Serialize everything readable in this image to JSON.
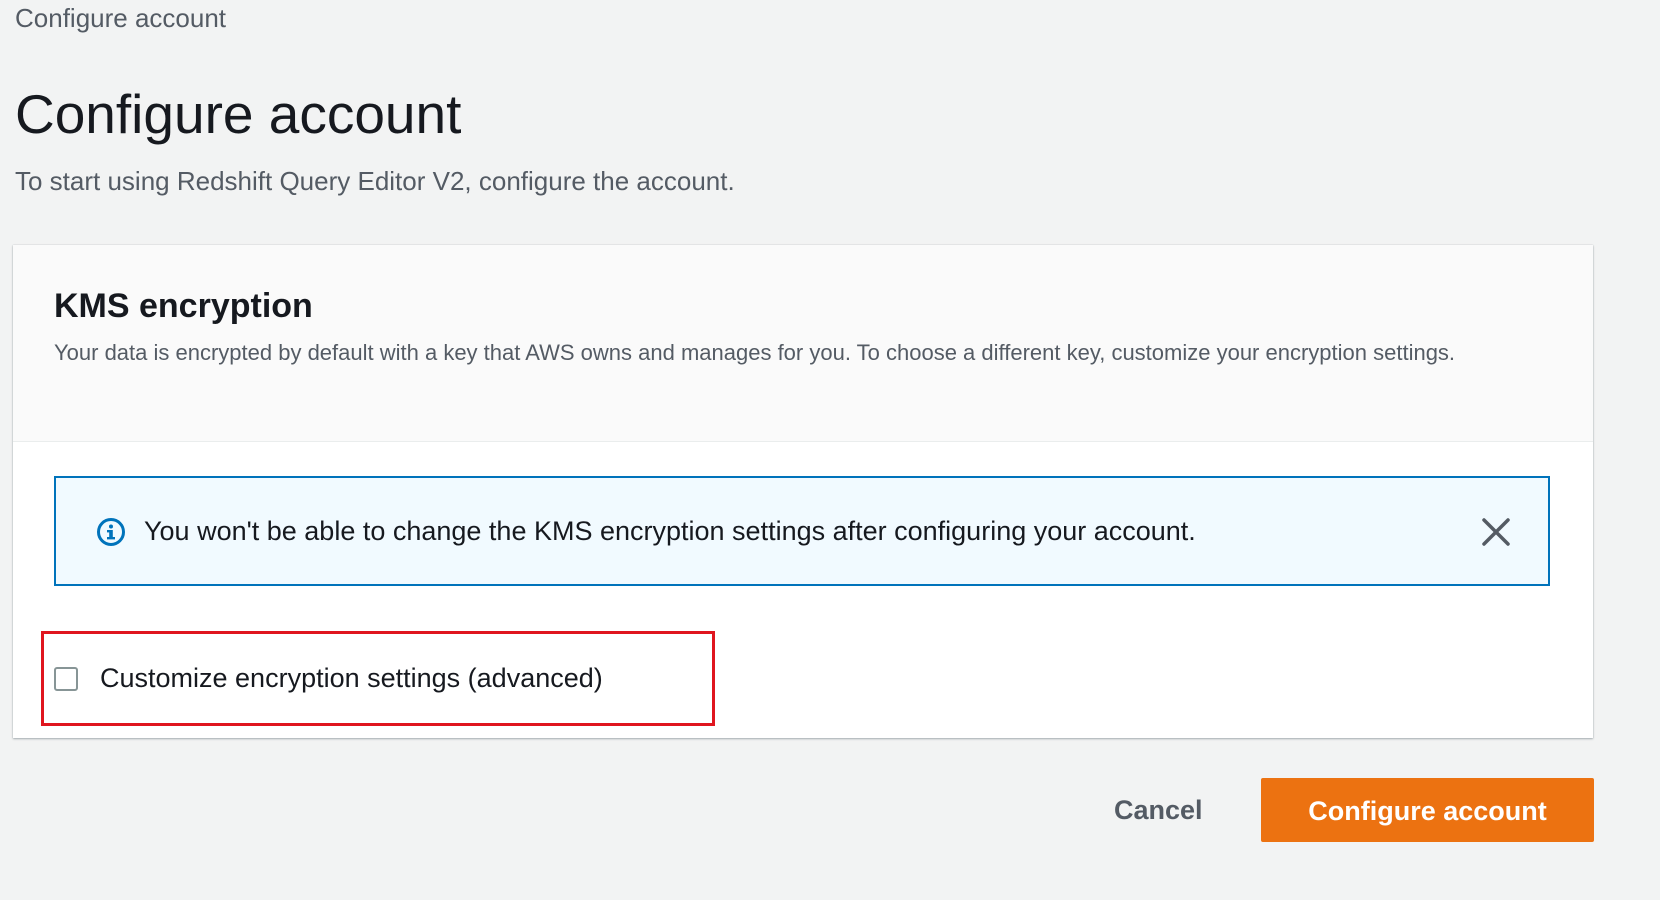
{
  "breadcrumb": {
    "label": "Configure account"
  },
  "page": {
    "title": "Configure account",
    "subtitle": "To start using Redshift Query Editor V2, configure the account."
  },
  "kms": {
    "title": "KMS encryption",
    "description": "Your data is encrypted by default with a key that AWS owns and manages for you. To choose a different key, customize your encryption settings.",
    "alert": {
      "icon": "info-icon",
      "text": "You won't be able to change the KMS encryption settings after configuring your account.",
      "close_icon": "close-icon"
    },
    "checkbox": {
      "label": "Customize encryption settings (advanced)",
      "checked": false
    }
  },
  "actions": {
    "cancel_label": "Cancel",
    "submit_label": "Configure account"
  },
  "colors": {
    "primary": "#ec7211",
    "info_border": "#0073bb",
    "info_background": "#f1faff",
    "highlight": "#e0161f"
  }
}
